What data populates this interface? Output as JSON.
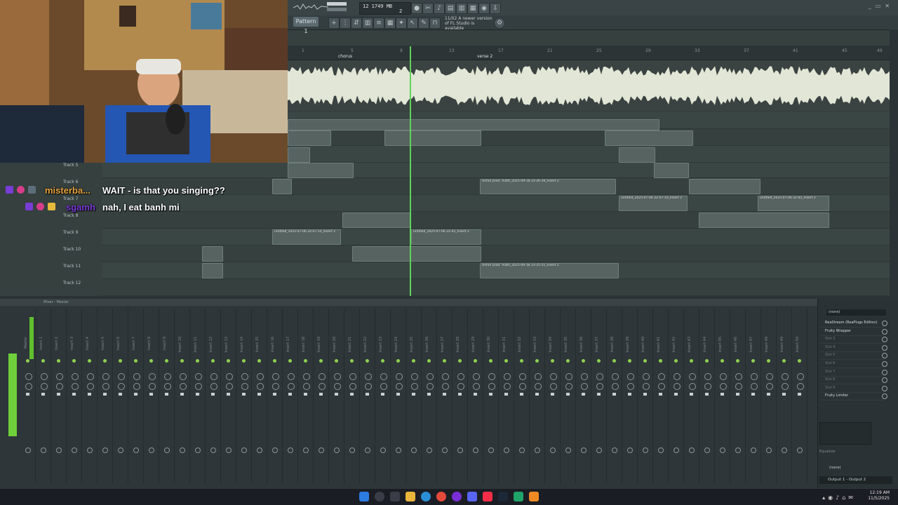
{
  "app": {
    "name": "FL Studio",
    "pattern_label": "Pattern 1",
    "cpu_readout": "12  1749 MB",
    "cpu_sub": "2",
    "update_notice": "11/02  A newer version of FL Studio is available"
  },
  "playlist": {
    "markers": [
      "chorus",
      "verse 2"
    ],
    "ruler_ticks": [
      "1",
      "5",
      "9",
      "13",
      "17",
      "21",
      "25",
      "29",
      "33",
      "37",
      "41",
      "45",
      "49"
    ],
    "tracks": [
      {
        "label": "Track 5"
      },
      {
        "label": "Track 6"
      },
      {
        "label": "Track 7"
      },
      {
        "label": "Track 8"
      },
      {
        "label": "Track 9"
      },
      {
        "label": "Track 10"
      },
      {
        "label": "Track 11"
      },
      {
        "label": "Track 12"
      }
    ],
    "clips": [
      {
        "track": 4,
        "name": "untitled_2025-07-06 22-07-10_Insert 2"
      },
      {
        "track": 4,
        "name": "untitled_2025-07-06 22-45_Insert 2"
      },
      {
        "track": 1,
        "name": "Unfair prod. matti_2025-09-18 23-26-39_Insert 2"
      },
      {
        "track": 2,
        "name": "untitled_2025-07-06 22-07-10_Insert 2"
      },
      {
        "track": 2,
        "name": "untitled_2025-07-06 22-45_Insert 2"
      },
      {
        "track": 6,
        "name": "Unfair prod. matti_2025-09-18 23-25-55_Insert 2"
      }
    ]
  },
  "chat": {
    "messages": [
      {
        "user": "misterba...",
        "text": "WAIT - is that you singing??"
      },
      {
        "user": "sgamh",
        "text": "nah, I eat banh mi"
      }
    ]
  },
  "mixer": {
    "title": "Mixer - Master",
    "strips": [
      "Master",
      "Insert 1",
      "Insert 2",
      "Insert 3",
      "Insert 4",
      "Insert 5",
      "Insert 6",
      "Insert 7",
      "Insert 8",
      "Insert 9",
      "Insert 10",
      "Insert 11",
      "Insert 12",
      "Insert 13",
      "Insert 14",
      "Insert 15",
      "Insert 16",
      "Insert 17",
      "Insert 18",
      "Insert 19",
      "Insert 20",
      "Insert 21",
      "Insert 22",
      "Insert 23",
      "Insert 24",
      "Insert 25",
      "Insert 26",
      "Insert 27",
      "Insert 28",
      "Insert 29",
      "Insert 30",
      "Insert 31",
      "Insert 32",
      "Insert 33",
      "Insert 34",
      "Insert 35",
      "Insert 36",
      "Insert 37",
      "Insert 38",
      "Insert 39",
      "Insert 40",
      "Insert 41",
      "Insert 42",
      "Insert 43",
      "Insert 44",
      "Insert 45",
      "Insert 46",
      "Insert 47",
      "Insert 48",
      "Insert 49",
      "Insert 50"
    ]
  },
  "fx": {
    "input": "(none)",
    "slots": [
      {
        "label": "ReaStream (ReaPlugs Edition)",
        "active": true
      },
      {
        "label": "Fruity Wrapper",
        "active": true
      },
      {
        "label": "Slot 3",
        "active": false
      },
      {
        "label": "Slot 4",
        "active": false
      },
      {
        "label": "Slot 5",
        "active": false
      },
      {
        "label": "Slot 6",
        "active": false
      },
      {
        "label": "Slot 7",
        "active": false
      },
      {
        "label": "Slot 8",
        "active": false
      },
      {
        "label": "Slot 9",
        "active": false
      },
      {
        "label": "Fruity Limiter",
        "active": true
      }
    ],
    "eq_label": "Equalizer",
    "none_label": "(none)",
    "output": "Output 1 - Output 2"
  },
  "taskbar": {
    "time": "12:19 AM",
    "date": "11/5/2025"
  },
  "colors": {
    "playhead": "#5fd35a",
    "chat_user1": "#e6a23c",
    "chat_user2": "#7b3bd6",
    "meter": "#6ecf3a"
  }
}
